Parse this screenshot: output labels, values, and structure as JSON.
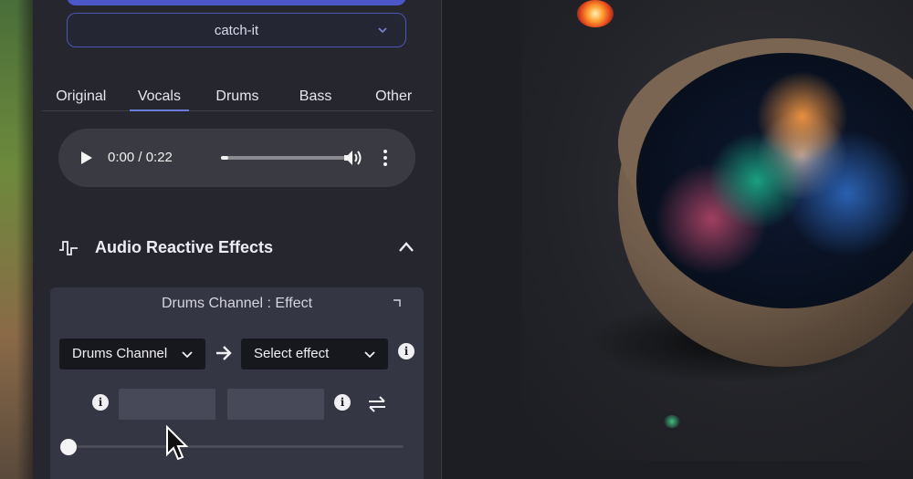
{
  "project": {
    "selected": "catch-it"
  },
  "tabs": [
    {
      "label": "Original",
      "active": false
    },
    {
      "label": "Vocals",
      "active": true
    },
    {
      "label": "Drums",
      "active": false
    },
    {
      "label": "Bass",
      "active": false
    },
    {
      "label": "Other",
      "active": false
    }
  ],
  "player": {
    "time": "0:00 / 0:22",
    "progress": 0.0
  },
  "section": {
    "title": "Audio Reactive Effects"
  },
  "effect_card": {
    "title": "Drums Channel : Effect",
    "channel_select": "Drums Channel",
    "effect_select": "Select effect",
    "min_value": "",
    "max_value": ""
  },
  "icons": {
    "play": "play-icon",
    "volume": "volume-icon",
    "more": "more-vertical-icon",
    "wave": "waveform-icon",
    "collapse": "chevron-up-icon",
    "arrow": "arrow-right-icon",
    "info": "info-icon",
    "swap": "swap-icon"
  },
  "colors": {
    "accent": "#4b57c9",
    "panel": "#25262e",
    "card": "#353643"
  },
  "preview": {
    "image": "cosmic nebula in a ceramic bowl with flames"
  }
}
